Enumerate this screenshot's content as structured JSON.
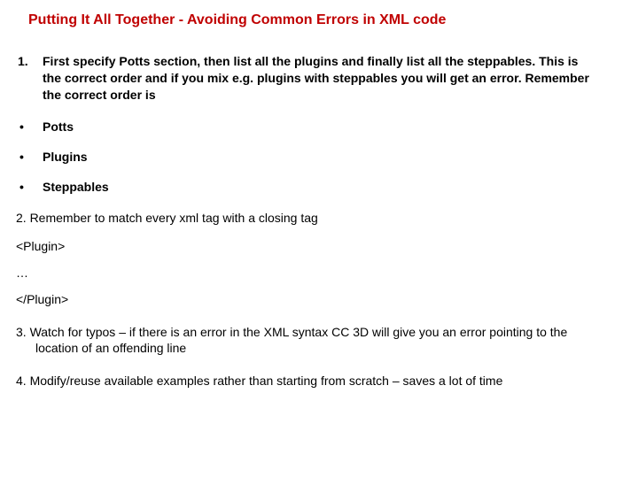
{
  "title": "Putting It All Together - Avoiding Common Errors in XML code",
  "item1": {
    "number": "1.",
    "text": "First specify Potts section, then list all the plugins and finally list all the steppables. This is the correct order and if you mix e.g. plugins with steppables you will get an error. Remember the correct order is"
  },
  "bullets": [
    {
      "mark": "•",
      "label": "Potts"
    },
    {
      "mark": "•",
      "label": "Plugins"
    },
    {
      "mark": "•",
      "label": "Steppables"
    }
  ],
  "item2": "2. Remember to match every xml tag with a closing tag",
  "code": {
    "open": "<Plugin>",
    "mid": "…",
    "close": "</Plugin>"
  },
  "item3": "3. Watch for typos – if there is an error in the XML syntax CC 3D will give you an error pointing to the location of an offending line",
  "item4": "4. Modify/reuse available examples rather than starting from scratch – saves a lot of time"
}
